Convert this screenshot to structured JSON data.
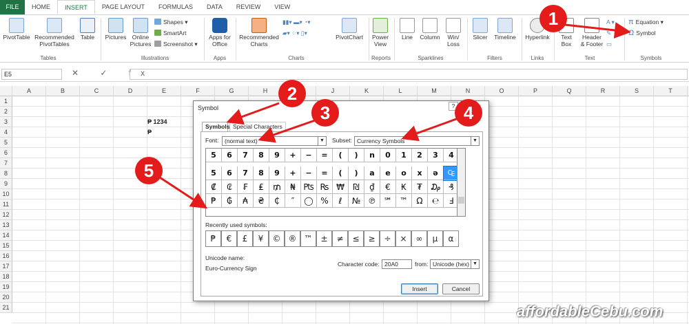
{
  "tabs": [
    "FILE",
    "HOME",
    "INSERT",
    "PAGE LAYOUT",
    "FORMULAS",
    "DATA",
    "REVIEW",
    "VIEW"
  ],
  "ribbon": {
    "pivottable": "PivotTable",
    "recommended_pivottables": "Recommended\nPivotTables",
    "table": "Table",
    "group_tables": "Tables",
    "pictures": "Pictures",
    "online_pictures": "Online\nPictures",
    "shapes": "Shapes",
    "smartart": "SmartArt",
    "screenshot": "Screenshot",
    "group_illustrations": "Illustrations",
    "apps_for_office": "Apps for\nOffice",
    "group_apps": "Apps",
    "recommended_charts": "Recommended\nCharts",
    "pivotchart": "PivotChart",
    "group_charts": "Charts",
    "power_view": "Power\nView",
    "group_reports": "Reports",
    "line": "Line",
    "column": "Column",
    "win_loss": "Win/\nLoss",
    "group_sparklines": "Sparklines",
    "slicer": "Slicer",
    "timeline": "Timeline",
    "group_filters": "Filters",
    "hyperlink": "Hyperlink",
    "group_links": "Links",
    "text_box": "Text\nBox",
    "header_footer": "Header\n& Footer",
    "group_text": "Text",
    "equation": "Equation",
    "symbol": "Symbol",
    "group_symbols": "Symbols"
  },
  "formula_bar": {
    "name_box": "E5",
    "buttons": "✕ ✓ fx",
    "value": ""
  },
  "columns": [
    "A",
    "B",
    "C",
    "D",
    "E",
    "F",
    "G",
    "H",
    "I",
    "J",
    "K",
    "L",
    "M",
    "N",
    "O",
    "P",
    "Q",
    "R",
    "S",
    "T"
  ],
  "rows": [
    "1",
    "2",
    "3",
    "4",
    "5",
    "6",
    "7",
    "8",
    "9",
    "10",
    "11",
    "12",
    "13",
    "14",
    "15",
    "16",
    "17",
    "18",
    "19",
    "20",
    "21"
  ],
  "cells": {
    "e3": "₱ 1234",
    "e4": "₱"
  },
  "dialog": {
    "title": "Symbol",
    "help": "?",
    "close": "✕",
    "tab_symbols": "Symbols",
    "tab_special": "Special Characters",
    "font_label": "Font:",
    "font_value": "(normal text)",
    "subset_label": "Subset:",
    "subset_value": "Currency Symbols",
    "rows": [
      [
        "5",
        "6",
        "7",
        "8",
        "9",
        "+",
        "−",
        "=",
        "(",
        ")",
        "n",
        "0",
        "1",
        "2",
        "3",
        "4"
      ],
      [
        "5",
        "6",
        "7",
        "8",
        "9",
        "+",
        "−",
        "=",
        "(",
        ")",
        "a",
        "e",
        "o",
        "x",
        "ə",
        ""
      ],
      [
        "₡",
        "₢",
        "₣",
        "₤",
        "₥",
        "₦",
        "₧",
        "₨",
        "₩",
        "₪",
        "₫",
        "€",
        "₭",
        "₮",
        "₯",
        "₰"
      ],
      [
        "₱",
        "₲",
        "₳",
        "₴",
        "₵",
        "″",
        "◯",
        "%",
        "ℓ",
        "№",
        "℗",
        "℠",
        "™",
        "Ω",
        "℮",
        "Ⅎ"
      ]
    ],
    "highlight_symbol": "₠",
    "recent_label": "Recently used symbols:",
    "recent": [
      "₱",
      "€",
      "£",
      "¥",
      "©",
      "®",
      "™",
      "±",
      "≠",
      "≤",
      "≥",
      "÷",
      "×",
      "∞",
      "µ",
      "α"
    ],
    "unicode_name_label": "Unicode name:",
    "unicode_name": "Euro-Currency Sign",
    "char_code_label": "Character code:",
    "char_code": "20A0",
    "from_label": "from:",
    "from_value": "Unicode (hex)",
    "insert": "Insert",
    "cancel": "Cancel"
  },
  "annotations": [
    "1",
    "2",
    "3",
    "4",
    "5"
  ],
  "watermark": "affordableCebu.com",
  "colors": {
    "excel_green": "#217346",
    "annotation_red": "#e41b1b",
    "highlight": "#3399ff"
  }
}
